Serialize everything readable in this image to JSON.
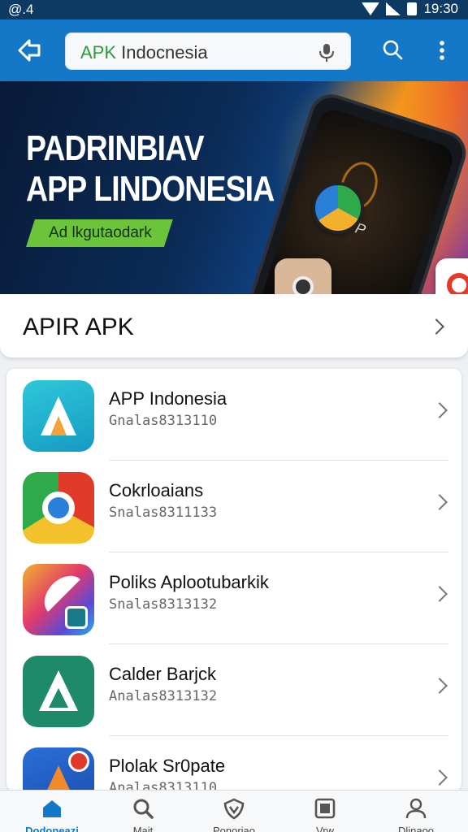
{
  "status_bar": {
    "left": "@.4",
    "time": "19:30"
  },
  "app_bar": {
    "search_prefix": "APK",
    "search_value": "Indocnesia"
  },
  "banner": {
    "title_line1": "PADRINBIAV",
    "title_line2": "APP LINDONESIA",
    "tag": "Ad lkgutaodark",
    "phone_text": "APP"
  },
  "section": {
    "title": "APIR APK"
  },
  "apps": [
    {
      "name": "APP Indonesia",
      "sub": "Gnalas8313110",
      "icon": "app-indonesia-icon"
    },
    {
      "name": "Cokrloaians",
      "sub": "Snalas8311133",
      "icon": "chrome-like-icon"
    },
    {
      "name": "Poliks Aplootubarkik",
      "sub": "Snalas8313132",
      "icon": "feather-app-icon"
    },
    {
      "name": "Calder Barjck",
      "sub": "Analas8313132",
      "icon": "triangle-app-icon"
    },
    {
      "name": "Plolak Sr0pate",
      "sub": "Analas8313110",
      "icon": "notification-app-icon"
    }
  ],
  "bottom_nav": [
    {
      "label": "Dodoneazi",
      "icon": "home-icon",
      "active": true
    },
    {
      "label": "Mait",
      "icon": "search-icon",
      "active": false
    },
    {
      "label": "Ponoriao",
      "icon": "shield-icon",
      "active": false
    },
    {
      "label": "Vrw",
      "icon": "app-icon",
      "active": false
    },
    {
      "label": "Dlinaoo",
      "icon": "profile-icon",
      "active": false
    }
  ],
  "colors": {
    "app_bar": "#1478c8",
    "status_bar": "#0d3a63",
    "accent_green": "#2e9b3a",
    "tag_green": "#6cc43a"
  }
}
